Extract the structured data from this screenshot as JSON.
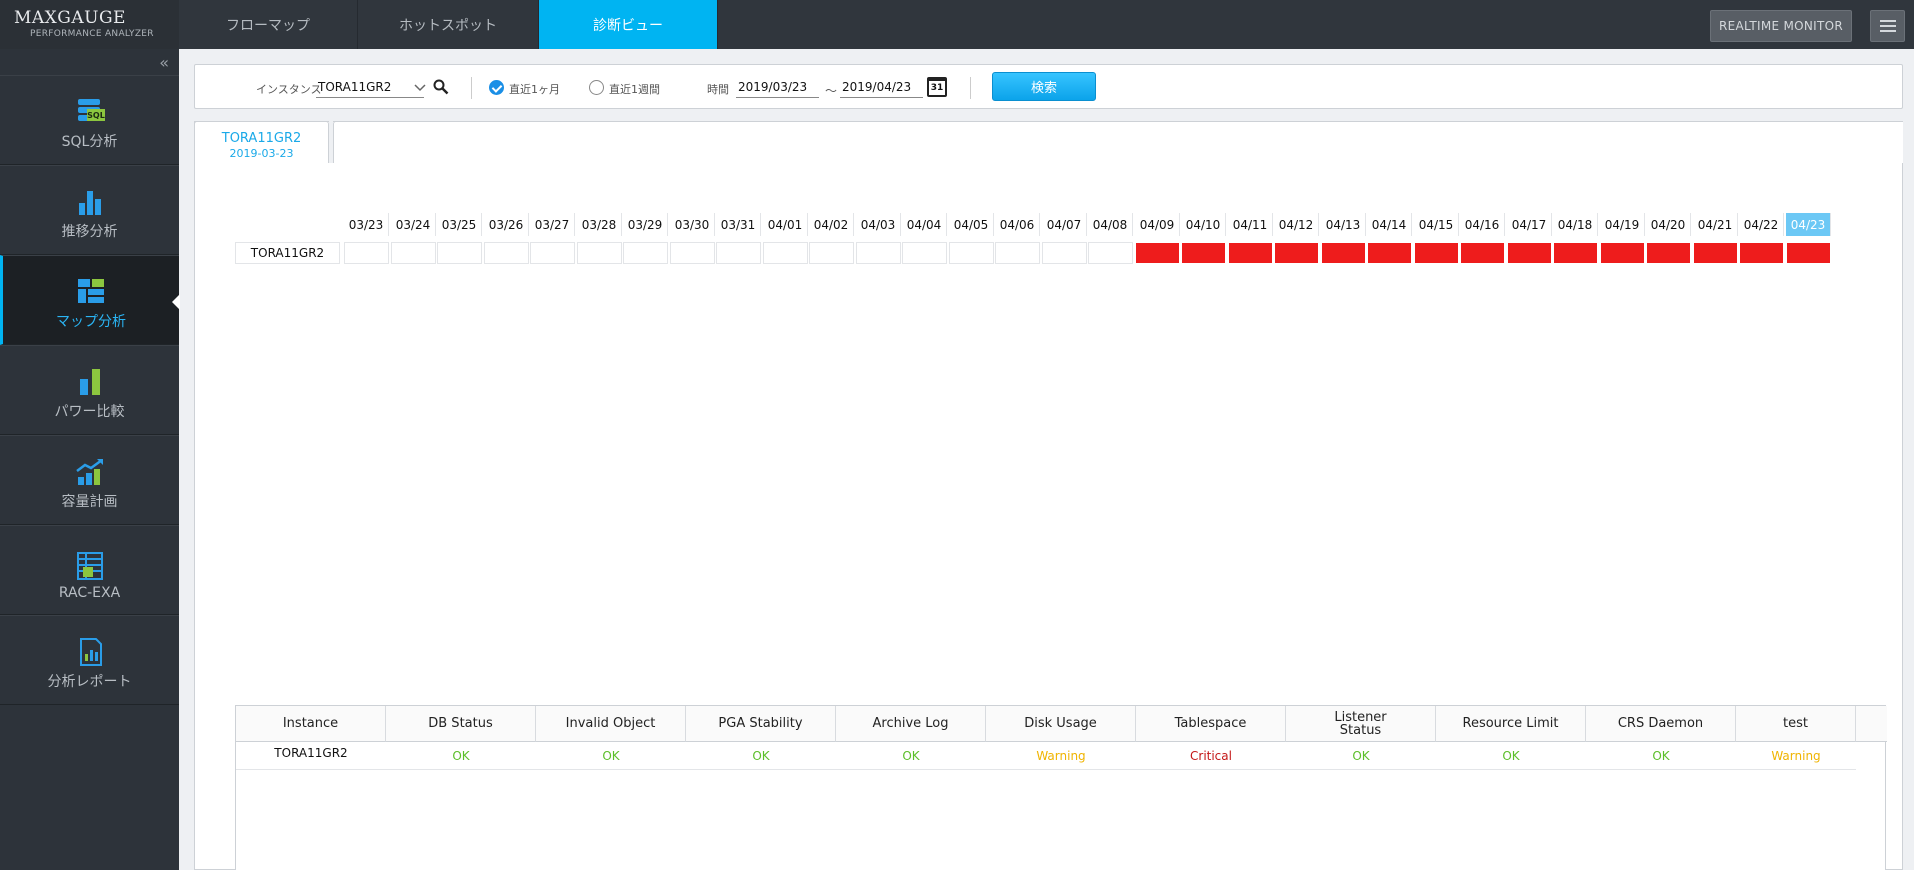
{
  "app": {
    "brand": "MAXGAUGE",
    "brand_sub": "PERFORMANCE ANALYZER",
    "realtime_label": "REALTIME MONITOR"
  },
  "top_tabs": [
    {
      "label": "フローマップ",
      "active": false
    },
    {
      "label": "ホットスポット",
      "active": false
    },
    {
      "label": "診断ビュー",
      "active": true
    }
  ],
  "sidebar": {
    "collapse_glyph": "«",
    "items": [
      {
        "label": "SQL分析",
        "icon": "sql-analysis-icon",
        "active": false
      },
      {
        "label": "推移分析",
        "icon": "trend-bar-icon",
        "active": false
      },
      {
        "label": "マップ分析",
        "icon": "map-grid-icon",
        "active": true
      },
      {
        "label": "パワー比較",
        "icon": "power-compare-icon",
        "active": false
      },
      {
        "label": "容量計画",
        "icon": "capacity-chart-icon",
        "active": false
      },
      {
        "label": "RAC-EXA",
        "icon": "rac-exa-icon",
        "active": false
      },
      {
        "label": "分析レポート",
        "icon": "report-icon",
        "active": false
      }
    ]
  },
  "search": {
    "instance_label": "インスタンス",
    "instance_value": "TORA11GR2",
    "radio_month": "直近1ヶ月",
    "radio_week": "直近1週間",
    "radio_selected": "month",
    "time_label": "時間",
    "date_from": "2019/03/23",
    "tilde": "～",
    "date_to": "2019/04/23",
    "calendar_day": "31",
    "search_button": "検索"
  },
  "instance_tab": {
    "name": "TORA11GR2",
    "date": "2019-03-23"
  },
  "calendar": {
    "row_label": "TORA11GR2",
    "dates": [
      "03/23",
      "03/24",
      "03/25",
      "03/26",
      "03/27",
      "03/28",
      "03/29",
      "03/30",
      "03/31",
      "04/01",
      "04/02",
      "04/03",
      "04/04",
      "04/05",
      "04/06",
      "04/07",
      "04/08",
      "04/09",
      "04/10",
      "04/11",
      "04/12",
      "04/13",
      "04/14",
      "04/15",
      "04/16",
      "04/17",
      "04/18",
      "04/19",
      "04/20",
      "04/21",
      "04/22",
      "04/23"
    ],
    "status": [
      "none",
      "none",
      "none",
      "none",
      "none",
      "none",
      "none",
      "none",
      "none",
      "none",
      "none",
      "none",
      "none",
      "none",
      "none",
      "none",
      "none",
      "critical",
      "critical",
      "critical",
      "critical",
      "critical",
      "critical",
      "critical",
      "critical",
      "critical",
      "critical",
      "critical",
      "critical",
      "critical",
      "critical",
      "critical"
    ],
    "today_index": 31,
    "colors": {
      "critical": "#ee1c1c",
      "today_header": "#6cc8f5"
    }
  },
  "status_table": {
    "headers": [
      "Instance",
      "DB Status",
      "Invalid Object",
      "PGA Stability",
      "Archive Log",
      "Disk Usage",
      "Tablespace",
      "Listener Status",
      "Resource Limit",
      "CRS Daemon",
      "test"
    ],
    "rows": [
      {
        "cells": [
          "TORA11GR2",
          "OK",
          "OK",
          "OK",
          "OK",
          "Warning",
          "Critical",
          "OK",
          "OK",
          "OK",
          "Warning"
        ]
      }
    ],
    "colors": {
      "OK": "#5cbf2a",
      "Warning": "#f0b400",
      "Critical": "#c41818"
    }
  }
}
